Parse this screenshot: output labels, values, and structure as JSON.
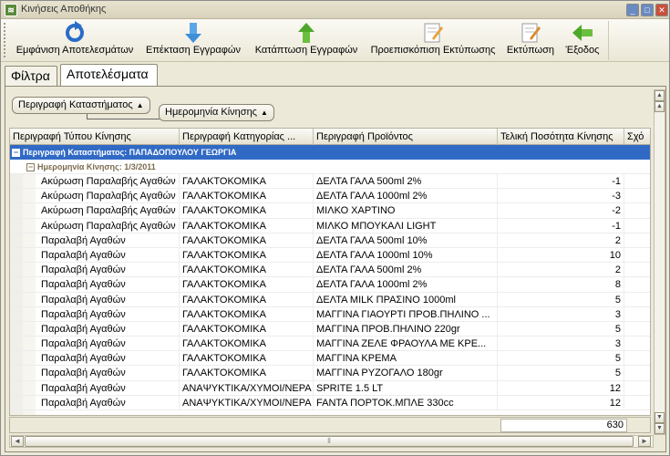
{
  "window": {
    "title": "Κινήσεις Αποθήκης"
  },
  "toolbar": {
    "show_results": "Εμφάνιση Αποτελεσμάτων",
    "expand_records": "Επέκταση Εγγραφών",
    "collapse_records": "Κατάπτωση Εγγραφών",
    "print_preview": "Προεπισκόπιση Εκτύπωσης",
    "print": "Εκτύπωση",
    "exit": "Έξοδος"
  },
  "tabs": {
    "filters": "Φίλτρα",
    "results": "Αποτελέσματα"
  },
  "grouping": {
    "chip1": "Περιγραφή Καταστήματος",
    "chip2": "Ημερομηνία Κίνησης",
    "sort_glyph": "▲"
  },
  "grid": {
    "columns": [
      "Περιγραφή Τύπου Κίνησης",
      "Περιγραφή Κατηγορίας ...",
      "Περιγραφή Προϊόντος",
      "Τελική Ποσότητα Κίνησης",
      "Σχό"
    ],
    "group_row": "Περιγραφή Καταστήματος: ΠΑΠΑΔΟΠΟΥΛΟΥ ΓΕΩΡΓΙΑ",
    "sub_group_row": "Ημερομηνία Κίνησης: 1/3/2011",
    "rows": [
      [
        "Ακύρωση Παραλαβής Αγαθών",
        "ΓΑΛΑΚΤΟΚΟΜΙΚΑ",
        "ΔΕΛΤΑ ΓΑΛΑ 500ml 2%",
        "-1"
      ],
      [
        "Ακύρωση Παραλαβής Αγαθών",
        "ΓΑΛΑΚΤΟΚΟΜΙΚΑ",
        "ΔΕΛΤΑ ΓΑΛΑ 1000ml 2%",
        "-3"
      ],
      [
        "Ακύρωση Παραλαβής Αγαθών",
        "ΓΑΛΑΚΤΟΚΟΜΙΚΑ",
        "ΜΙΛΚΟ ΧΑΡΤΙΝΟ",
        "-2"
      ],
      [
        "Ακύρωση Παραλαβής Αγαθών",
        "ΓΑΛΑΚΤΟΚΟΜΙΚΑ",
        "ΜΙΛΚΟ ΜΠΟΥΚΑΛΙ LIGHT",
        "-1"
      ],
      [
        "Παραλαβή Αγαθών",
        "ΓΑΛΑΚΤΟΚΟΜΙΚΑ",
        "ΔΕΛΤΑ ΓΑΛΑ 500ml 10%",
        "2"
      ],
      [
        "Παραλαβή Αγαθών",
        "ΓΑΛΑΚΤΟΚΟΜΙΚΑ",
        "ΔΕΛΤΑ ΓΑΛΑ 1000ml 10%",
        "10"
      ],
      [
        "Παραλαβή Αγαθών",
        "ΓΑΛΑΚΤΟΚΟΜΙΚΑ",
        "ΔΕΛΤΑ ΓΑΛΑ 500ml 2%",
        "2"
      ],
      [
        "Παραλαβή Αγαθών",
        "ΓΑΛΑΚΤΟΚΟΜΙΚΑ",
        "ΔΕΛΤΑ ΓΑΛΑ 1000ml 2%",
        "8"
      ],
      [
        "Παραλαβή Αγαθών",
        "ΓΑΛΑΚΤΟΚΟΜΙΚΑ",
        "ΔΕΛΤΑ MILK ΠΡΑΣΙΝΟ 1000ml",
        "5"
      ],
      [
        "Παραλαβή Αγαθών",
        "ΓΑΛΑΚΤΟΚΟΜΙΚΑ",
        "ΜΑΓΓΙΝΑ ΓΙΑΟΥΡΤΙ ΠΡΟΒ.ΠΗΛΙΝΟ ...",
        "3"
      ],
      [
        "Παραλαβή Αγαθών",
        "ΓΑΛΑΚΤΟΚΟΜΙΚΑ",
        "ΜΑΓΓΙΝΑ ΠΡΟΒ.ΠΗΛΙΝΟ 220gr",
        "5"
      ],
      [
        "Παραλαβή Αγαθών",
        "ΓΑΛΑΚΤΟΚΟΜΙΚΑ",
        "ΜΑΓΓΙΝΑ ΖΕΛΕ ΦΡΑΟΥΛΑ ΜΕ ΚΡΕ...",
        "3"
      ],
      [
        "Παραλαβή Αγαθών",
        "ΓΑΛΑΚΤΟΚΟΜΙΚΑ",
        "ΜΑΓΓΙΝΑ ΚΡΕΜΑ",
        "5"
      ],
      [
        "Παραλαβή Αγαθών",
        "ΓΑΛΑΚΤΟΚΟΜΙΚΑ",
        "ΜΑΓΓΙΝΑ ΡΥΖΟΓΑΛΟ 180gr",
        "5"
      ],
      [
        "Παραλαβή Αγαθών",
        "ΑΝΑΨΥΚΤΙΚΑ/ΧΥΜΟΙ/ΝΕΡΑ",
        "SPRITE 1.5 LT",
        "12"
      ],
      [
        "Παραλαβή Αγαθών",
        "ΑΝΑΨΥΚΤΙΚΑ/ΧΥΜΟΙ/ΝΕΡΑ",
        "FANTA ΠΟΡΤΟΚ.ΜΠΛΕ 330cc",
        "12"
      ]
    ],
    "total": "630"
  },
  "colors": {
    "group_row_bg": "#316ac5",
    "sub_group_text": "#7b6a4c"
  },
  "icons": {
    "show_results": "refresh-icon",
    "expand_records": "arrow-down-icon",
    "collapse_records": "arrow-up-icon",
    "print_preview": "preview-pencil-icon",
    "print": "print-pencil-icon",
    "exit": "arrow-left-icon"
  }
}
